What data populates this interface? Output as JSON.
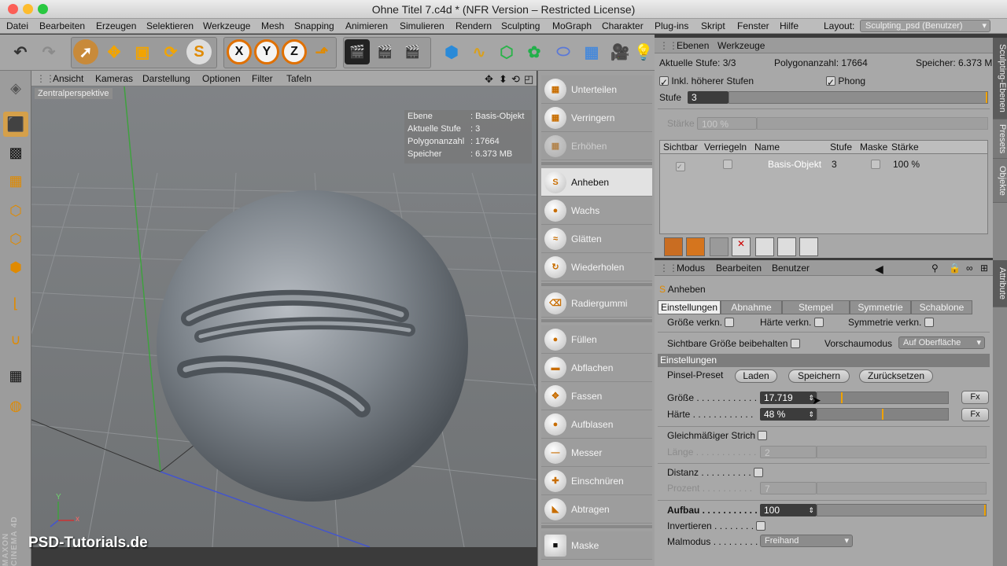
{
  "window": {
    "title": "Ohne Titel 7.c4d * (NFR Version – Restricted License)"
  },
  "menu": [
    "Datei",
    "Bearbeiten",
    "Erzeugen",
    "Selektieren",
    "Werkzeuge",
    "Mesh",
    "Snapping",
    "Animieren",
    "Simulieren",
    "Rendern",
    "Sculpting",
    "MoGraph",
    "Charakter",
    "Plug-ins",
    "Skript",
    "Fenster",
    "Hilfe"
  ],
  "layout": {
    "label": "Layout:",
    "value": "Sculpting_psd (Benutzer)"
  },
  "toolbar": {
    "x_label": "X",
    "y_label": "Y",
    "z_label": "Z"
  },
  "viewport": {
    "menu": [
      "Ansicht",
      "Kameras",
      "Darstellung",
      "Optionen",
      "Filter",
      "Tafeln"
    ],
    "camera_label": "Zentralperspektive",
    "hud": [
      {
        "k": "Ebene",
        "v": "Basis-Objekt"
      },
      {
        "k": "Aktuelle Stufe",
        "v": "3"
      },
      {
        "k": "Polygonanzahl",
        "v": "17664"
      },
      {
        "k": "Speicher",
        "v": "6.373 MB"
      }
    ],
    "axis": {
      "x": "x",
      "y": "Y",
      "z": "z"
    },
    "watermark": "PSD-Tutorials.de",
    "brand": "MAXON CINEMA 4D"
  },
  "sculpt_tools": [
    {
      "label": "Unterteilen",
      "state": "normal"
    },
    {
      "label": "Verringern",
      "state": "normal"
    },
    {
      "label": "Erhöhen",
      "state": "dim"
    },
    {
      "label": "Anheben",
      "state": "active"
    },
    {
      "label": "Wachs",
      "state": "normal"
    },
    {
      "label": "Glätten",
      "state": "normal"
    },
    {
      "label": "Wiederholen",
      "state": "normal"
    },
    {
      "label": "Radiergummi",
      "state": "normal"
    },
    {
      "label": "Füllen",
      "state": "normal"
    },
    {
      "label": "Abflachen",
      "state": "normal"
    },
    {
      "label": "Fassen",
      "state": "normal"
    },
    {
      "label": "Aufblasen",
      "state": "normal"
    },
    {
      "label": "Messer",
      "state": "normal"
    },
    {
      "label": "Einschnüren",
      "state": "normal"
    },
    {
      "label": "Abtragen",
      "state": "normal"
    },
    {
      "label": "Maske",
      "state": "normal"
    }
  ],
  "layers_panel": {
    "tabs": [
      "Ebenen",
      "Werkzeuge"
    ],
    "aktuelle_stufe": "Aktuelle Stufe: 3/3",
    "polygonanzahl": "Polygonanzahl: 17664",
    "speicher": "Speicher: 6.373 MB",
    "inkl_label": "Inkl. höherer Stufen",
    "phong_label": "Phong",
    "stufe_label": "Stufe",
    "stufe_value": "3",
    "staerke_label": "Stärke",
    "staerke_value": "100 %",
    "columns": [
      "Sichtbar",
      "Verriegeln",
      "Name",
      "Stufe",
      "Maske",
      "Stärke"
    ],
    "row": {
      "name": "Basis-Objekt",
      "stufe": "3",
      "staerke": "100 %"
    }
  },
  "attributes": {
    "menu": [
      "Modus",
      "Bearbeiten",
      "Benutzer"
    ],
    "tool_name": "Anheben",
    "tabs": [
      "Einstellungen",
      "Abnahme",
      "Stempel",
      "Symmetrie",
      "Schablone"
    ],
    "groesse_verkn": "Größe verkn.",
    "haerte_verkn": "Härte verkn.",
    "symmetrie_verkn": "Symmetrie verkn.",
    "sichtbare_groesse": "Sichtbare Größe beibehalten",
    "vorschaumodus_label": "Vorschaumodus",
    "vorschaumodus_value": "Auf Oberfläche",
    "section": "Einstellungen",
    "pinsel_preset": "Pinsel-Preset",
    "laden": "Laden",
    "speichern": "Speichern",
    "zuruecksetzen": "Zurücksetzen",
    "groesse_label": "Größe . . . . . . . . . . . .",
    "groesse_value": "17.719",
    "haerte_label": "Härte . . . . . . . . . . . .",
    "haerte_value": "48 %",
    "fx": "Fx",
    "gleichmaessig": "Gleichmäßiger Strich",
    "laenge_label": "Länge . . . . . . . . . . . .",
    "laenge_value": "2",
    "distanz_label": "Distanz . . . . . . . . . .",
    "prozent_label": "Prozent . . . . . . . . . .",
    "prozent_value": "7",
    "aufbau_label": "Aufbau . . . . . . . . . . .",
    "aufbau_value": "100",
    "invertieren_label": "Invertieren . . . . . . . .",
    "malmodus_label": "Malmodus . . . . . . . . .",
    "malmodus_value": "Freihand"
  },
  "side_tabs": [
    "Sculpting-Ebenen",
    "Presets",
    "Objekte",
    "Attribute"
  ],
  "colors": {
    "accent": "#f0a200",
    "brush_icon": "#e08a00"
  }
}
